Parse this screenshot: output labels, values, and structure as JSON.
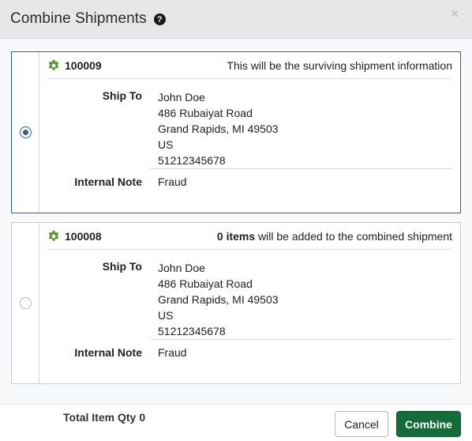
{
  "dialog": {
    "title": "Combine Shipments",
    "help_icon_glyph": "?",
    "close_icon_glyph": "×"
  },
  "shipments": [
    {
      "id": "100009",
      "selected": true,
      "message": "This will be the surviving shipment information",
      "ship_to_label": "Ship To",
      "address": [
        "John Doe",
        "486 Rubaiyat Road",
        "Grand Rapids, MI 49503",
        "US",
        "51212345678"
      ],
      "note_label": "Internal Note",
      "note_value": "Fraud"
    },
    {
      "id": "100008",
      "selected": false,
      "items_count": "0 items",
      "message_suffix": " will be added to the combined shipment",
      "ship_to_label": "Ship To",
      "address": [
        "John Doe",
        "486 Rubaiyat Road",
        "Grand Rapids, MI 49503",
        "US",
        "51212345678"
      ],
      "note_label": "Internal Note",
      "note_value": "Fraud"
    }
  ],
  "footer": {
    "total_label": "Total Item Qty",
    "total_value": "0",
    "cancel_label": "Cancel",
    "combine_label": "Combine"
  },
  "colors": {
    "accent_blue": "#2d5ea8",
    "gear_green": "#5a9a2a",
    "combine_green": "#146c39"
  },
  "icons": {
    "gear": "gear-icon",
    "help": "help-icon",
    "close": "close-icon"
  }
}
